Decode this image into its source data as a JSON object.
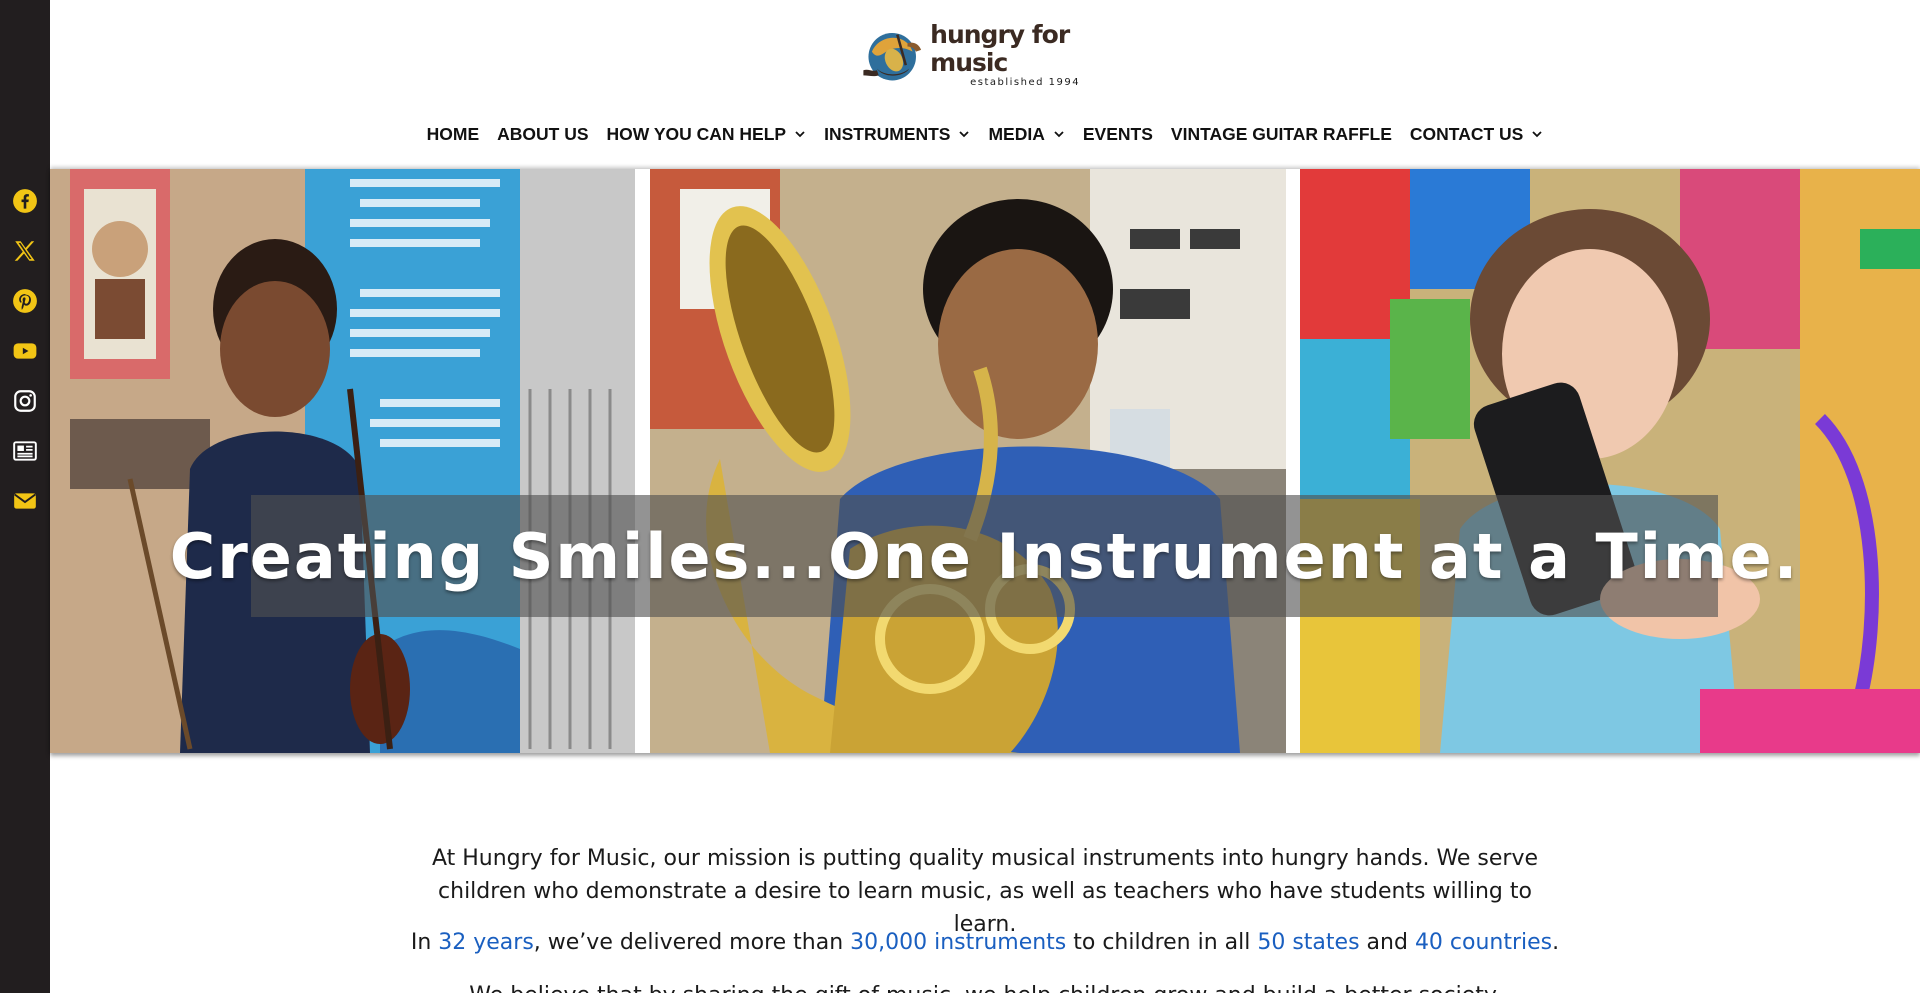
{
  "brand": {
    "name": "hungry for music",
    "tagline": "established 1994"
  },
  "colors": {
    "sidebar": "#221e1f",
    "social_icon": "#f2c515",
    "link": "#1a5fc0",
    "nav_text": "#111111"
  },
  "social": [
    {
      "icon": "facebook-icon"
    },
    {
      "icon": "x-icon"
    },
    {
      "icon": "pinterest-icon"
    },
    {
      "icon": "youtube-icon"
    },
    {
      "icon": "instagram-icon"
    },
    {
      "icon": "newspaper-icon"
    },
    {
      "icon": "email-icon"
    }
  ],
  "nav": {
    "items": [
      {
        "label": "HOME",
        "has_dropdown": false
      },
      {
        "label": "ABOUT US",
        "has_dropdown": false
      },
      {
        "label": "HOW YOU CAN HELP",
        "has_dropdown": true
      },
      {
        "label": "INSTRUMENTS",
        "has_dropdown": true
      },
      {
        "label": "MEDIA",
        "has_dropdown": true
      },
      {
        "label": "EVENTS",
        "has_dropdown": false
      },
      {
        "label": "VINTAGE GUITAR RAFFLE",
        "has_dropdown": false
      },
      {
        "label": "CONTACT US",
        "has_dropdown": true
      }
    ]
  },
  "hero": {
    "headline": "Creating Smiles...One Instrument at a Time.",
    "panels": [
      {
        "description": "girl with violin"
      },
      {
        "description": "boy with euphonium"
      },
      {
        "description": "girl hugging instrument case"
      }
    ]
  },
  "content": {
    "mission": "At Hungry for Music, our mission is putting quality musical instruments into hungry hands. We serve children who demonstrate a desire to learn music, as well as teachers who have students willing to learn.",
    "stats": {
      "t1": "In ",
      "years": "32 years",
      "t2": ", we’ve delivered more than ",
      "instruments": "30,000 instruments",
      "t3": " to children in all ",
      "states": "50 states",
      "t4": " and ",
      "countries": "40 countries",
      "t5": "."
    },
    "cutoff_line": "We believe that by sharing the gift of music, we help children grow and build a better society."
  }
}
